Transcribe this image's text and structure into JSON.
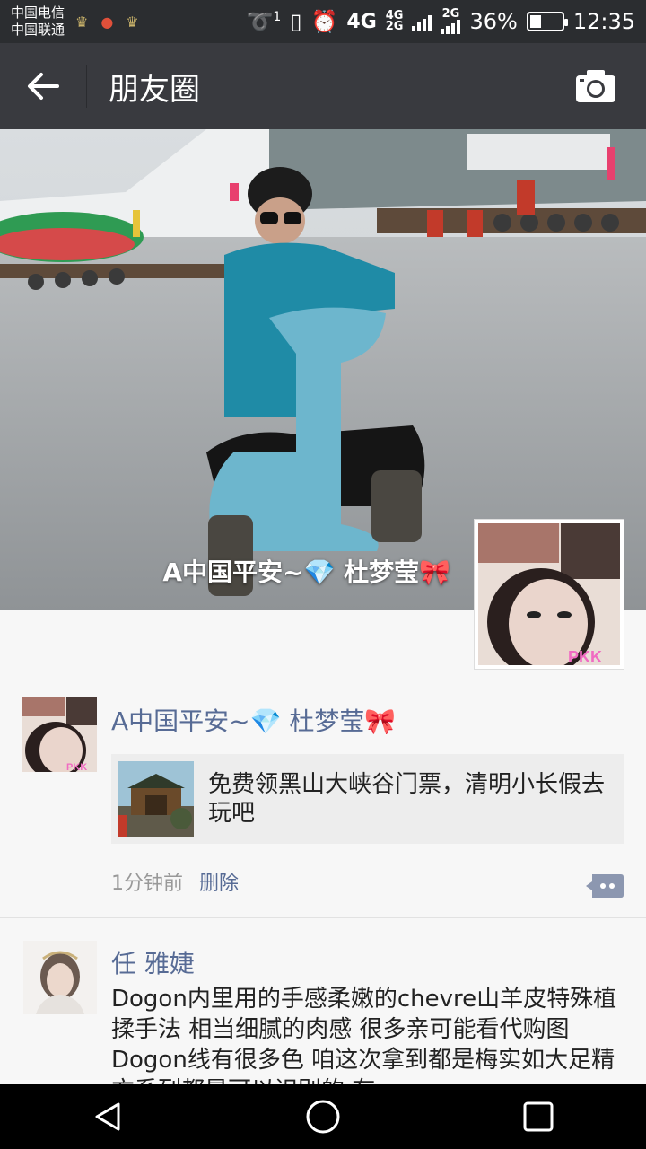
{
  "status_bar": {
    "carrier_1": "中国电信",
    "carrier_2": "中国联通",
    "sim_label": "1",
    "net_4g": "4G",
    "net_4g_small": "4G",
    "net_2g_small": "2G",
    "net_2g": "2G",
    "battery": "36%",
    "battery_level": 0.36,
    "time": "12:35"
  },
  "header": {
    "title": "朋友圈"
  },
  "cover": {
    "owner_name": "A中国平安~💎 杜梦莹🎀"
  },
  "posts": [
    {
      "author": "A中国平安~💎 杜梦莹🎀",
      "share_text": "免费领黑山大峡谷门票，清明小长假去玩吧",
      "time": "1分钟前",
      "delete_label": "删除"
    },
    {
      "author": "任 雅婕",
      "text": "Dogon内里用的手感柔嫩的chevre山羊皮特殊植揉手法 相当细腻的肉感 很多亲可能看代购图 Dogon线有很多色 咱这次拿到都是梅实如大足精方系列都是可以识别的 有"
    }
  ],
  "icons": {
    "back": "back-arrow-icon",
    "camera": "camera-icon",
    "comment": "comment-icon",
    "nav_back": "nav-back-icon",
    "nav_home": "nav-home-icon",
    "nav_recent": "nav-recent-icon"
  }
}
